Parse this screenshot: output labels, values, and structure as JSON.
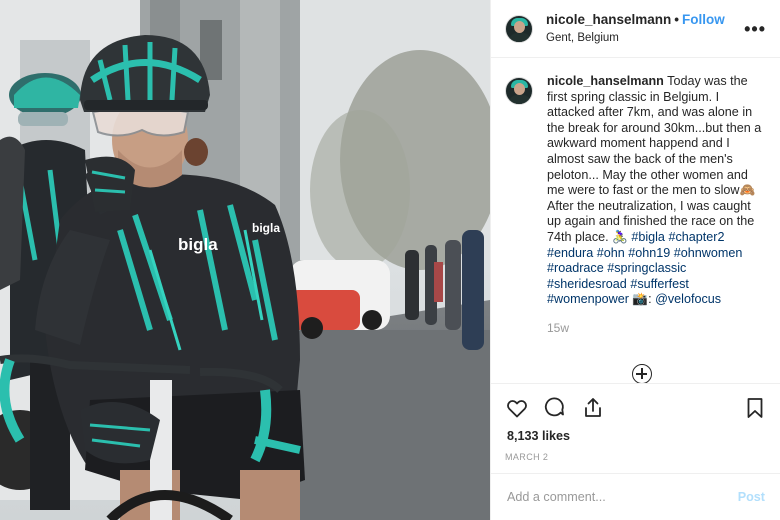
{
  "post": {
    "username": "nicole_hanselmann",
    "separator": "•",
    "follow_label": "Follow",
    "location": "Gent, Belgium",
    "more_icon": "more-horizontal-icon"
  },
  "caption": {
    "username": "nicole_hanselmann",
    "text_part1": " Today was the first spring classic in Belgium. I attacked after 7km, and was alone in the break for around 30km...but then a awkward moment happend and I almost saw the back of the men's peloton... May the other women and me were to fast or the men to slow",
    "emoji1": "🙈",
    "text_part2": "After the neutralization, I was caught up again and finished the race on the 74th place. ",
    "emoji2": "🚴‍♀️",
    "hashtags": [
      "#bigla",
      "#chapter2",
      "#endura",
      "#ohn",
      "#ohn19",
      "#ohnwomen",
      "#roadrace",
      "#springclassic",
      "#sheridesroad",
      "#sufferfest",
      "#womenpower"
    ],
    "camera_emoji": "📸",
    "credit": "@velofocus",
    "time_ago": "15w"
  },
  "actions": {
    "like_icon": "heart-icon",
    "comment_icon": "comment-icon",
    "share_icon": "share-icon",
    "save_icon": "bookmark-icon",
    "load_more_icon": "plus-circle-icon"
  },
  "stats": {
    "likes": "8,133 likes",
    "date": "MARCH 2"
  },
  "compose": {
    "placeholder": "Add a comment...",
    "post_label": "Post"
  },
  "photo": {
    "jersey_text": "bigla",
    "colors": {
      "jersey": "#2a2c30",
      "accent": "#2bbfae",
      "helmet": "#2f3437"
    }
  }
}
